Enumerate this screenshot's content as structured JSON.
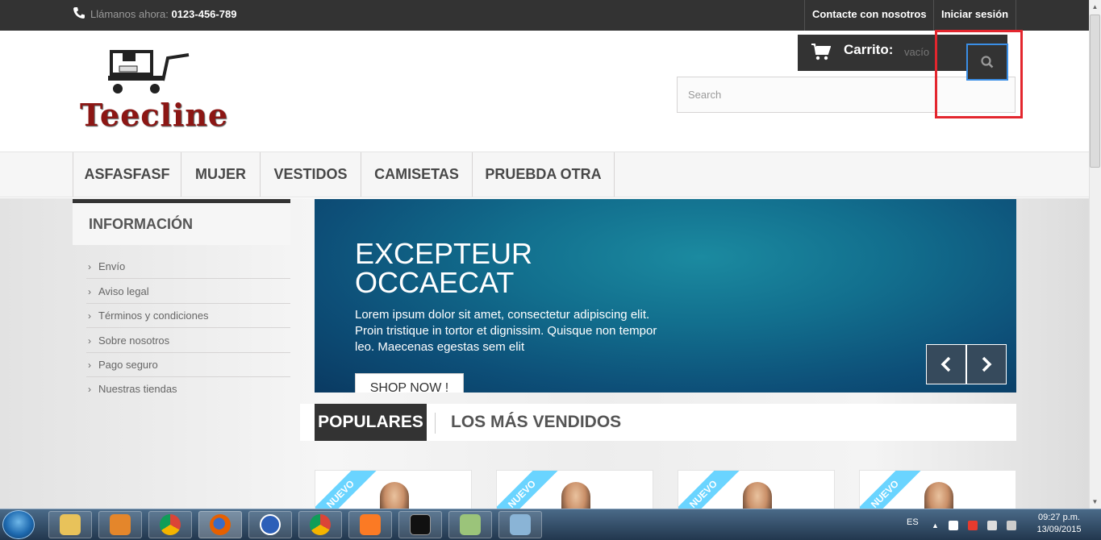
{
  "topbar": {
    "call_label": "Llámanos ahora:",
    "phone": "0123-456-789",
    "contact": "Contacte con nosotros",
    "login": "Iniciar sesión"
  },
  "header": {
    "logo_text": "Teecline",
    "cart_label": "Carrito:",
    "cart_value": "vacío",
    "search_placeholder": "Search"
  },
  "menu": {
    "items": [
      "ASFASFASF",
      "MUJER",
      "VESTIDOS",
      "CAMISETAS",
      "PRUEBDA OTRA"
    ]
  },
  "sidebar": {
    "title": "INFORMACIÓN",
    "items": [
      "Envío",
      "Aviso legal",
      "Términos y condiciones",
      "Sobre nosotros",
      "Pago seguro",
      "Nuestras tiendas"
    ]
  },
  "slider": {
    "title": "EXCEPTEUR OCCAECAT",
    "text": "Lorem ipsum dolor sit amet, consectetur adipiscing elit. Proin tristique in tortor et dignissim. Quisque non tempor leo. Maecenas egestas sem elit",
    "button": "SHOP NOW !"
  },
  "tabs": {
    "popular": "POPULARES",
    "best": "LOS MÁS VENDIDOS"
  },
  "products": {
    "badge": "NUEVO"
  },
  "taskbar": {
    "lang": "ES",
    "time": "09:27 p.m.",
    "date": "13/09/2015"
  },
  "colors": {
    "dark": "#333333",
    "accent_blue": "#3a8ee6",
    "highlight_red": "#e3262e",
    "badge": "#6ad4ff",
    "logo": "#8c1614"
  }
}
